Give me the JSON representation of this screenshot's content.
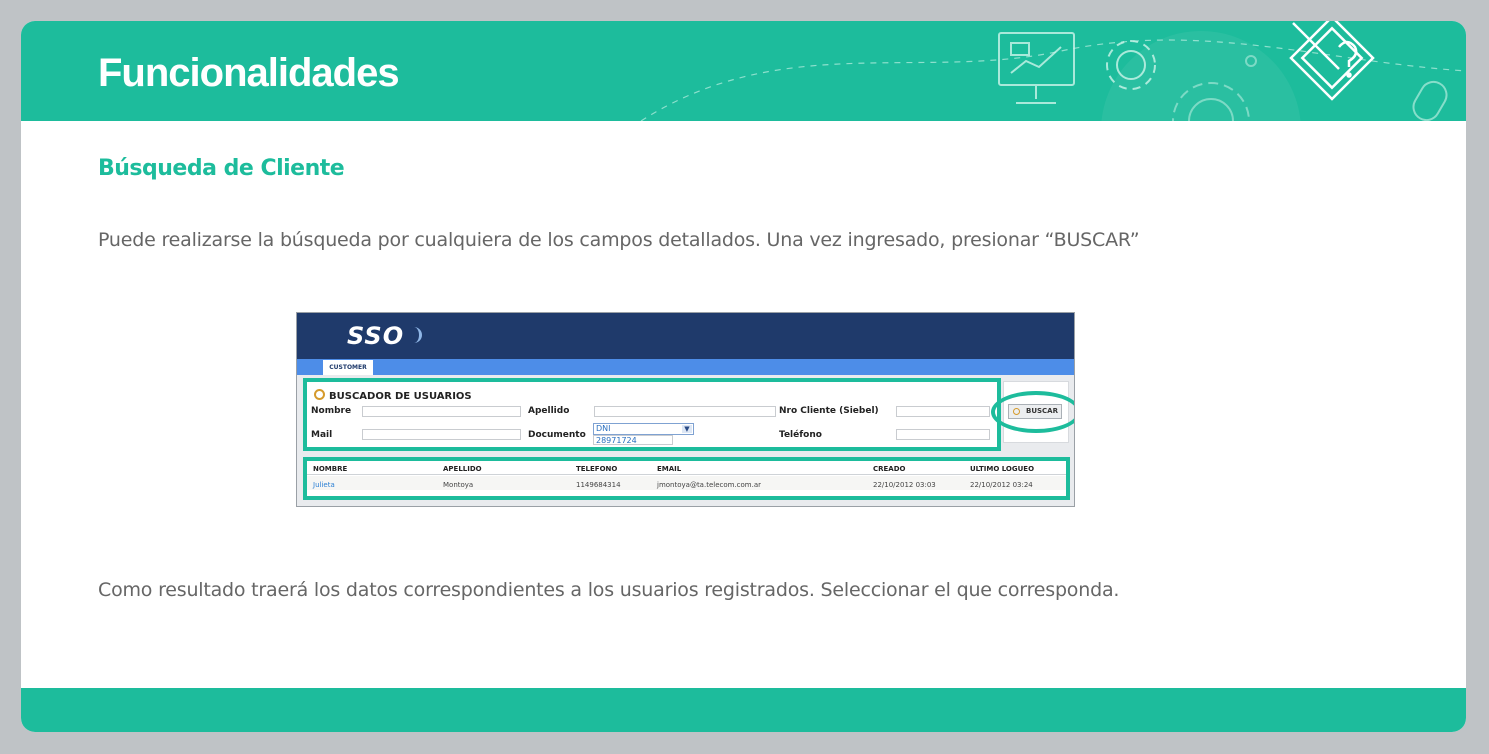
{
  "header": {
    "title": "Funcionalidades"
  },
  "section": {
    "subtitle": "Búsqueda de Cliente",
    "intro": "Puede realizarse la búsqueda por cualquiera de los campos detallados. Una vez ingresado, presionar “BUSCAR”",
    "outro": "Como resultado traerá los datos correspondientes a los usuarios registrados. Seleccionar el que corresponda."
  },
  "screenshot": {
    "logo": "SSO",
    "tab": "CUSTOMER",
    "form_title": "BUSCADOR DE USUARIOS",
    "labels": {
      "nombre": "Nombre",
      "apellido": "Apellido",
      "nro_cliente": "Nro Cliente (Siebel)",
      "mail": "Mail",
      "documento": "Documento",
      "telefono": "Teléfono"
    },
    "documento_type": "DNI",
    "documento_value": "28971724",
    "button": "BUSCAR",
    "columns": [
      "NOMBRE",
      "APELLIDO",
      "TELEFONO",
      "EMAIL",
      "CREADO",
      "ULTIMO LOGUEO"
    ],
    "row": [
      "Julieta",
      "Montoya",
      "1149684314",
      "jmontoya@ta.telecom.com.ar",
      "22/10/2012 03:03",
      "22/10/2012 03:24"
    ]
  },
  "colors": {
    "accent": "#1dbc9c",
    "sso_bar": "#1f3a6b",
    "sso_blue": "#4d8de8"
  },
  "icons": [
    "presentation-icon",
    "gear-icon",
    "pencil-question-icon",
    "mouse-icon",
    "search-icon"
  ]
}
